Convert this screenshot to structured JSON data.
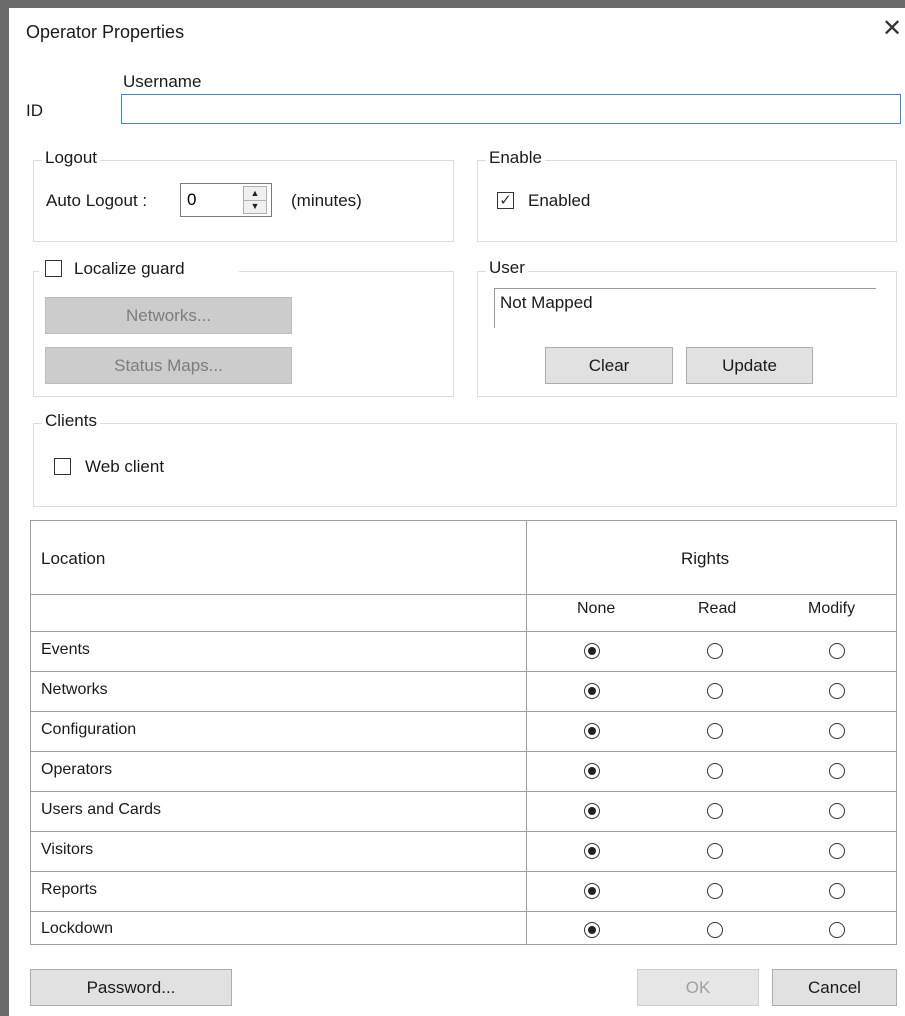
{
  "dialog": {
    "title": "Operator Properties",
    "close_icon": "close-icon"
  },
  "identity": {
    "id_label": "ID",
    "username_label": "Username",
    "username_value": ""
  },
  "logout": {
    "legend": "Logout",
    "auto_logout_label": "Auto Logout :",
    "auto_logout_value": "0",
    "units": "(minutes)"
  },
  "enable": {
    "legend": "Enable",
    "enabled_label": "Enabled",
    "enabled_checked": true
  },
  "localize": {
    "label": "Localize guard",
    "checked": false,
    "networks_button": "Networks...",
    "status_maps_button": "Status Maps..."
  },
  "user": {
    "legend": "User",
    "mapped_value": "Not Mapped",
    "clear_button": "Clear",
    "update_button": "Update"
  },
  "clients": {
    "legend": "Clients",
    "web_client_label": "Web client",
    "web_client_checked": false
  },
  "rights_table": {
    "location_header": "Location",
    "rights_header": "Rights",
    "columns": [
      "None",
      "Read",
      "Modify"
    ],
    "rows": [
      {
        "label": "Events",
        "selected": "None"
      },
      {
        "label": "Networks",
        "selected": "None"
      },
      {
        "label": "Configuration",
        "selected": "None"
      },
      {
        "label": "Operators",
        "selected": "None"
      },
      {
        "label": "Users and Cards",
        "selected": "None"
      },
      {
        "label": "Visitors",
        "selected": "None"
      },
      {
        "label": "Reports",
        "selected": "None"
      },
      {
        "label": "Lockdown",
        "selected": "None"
      }
    ]
  },
  "footer": {
    "password_button": "Password...",
    "ok_button": "OK",
    "cancel_button": "Cancel"
  }
}
